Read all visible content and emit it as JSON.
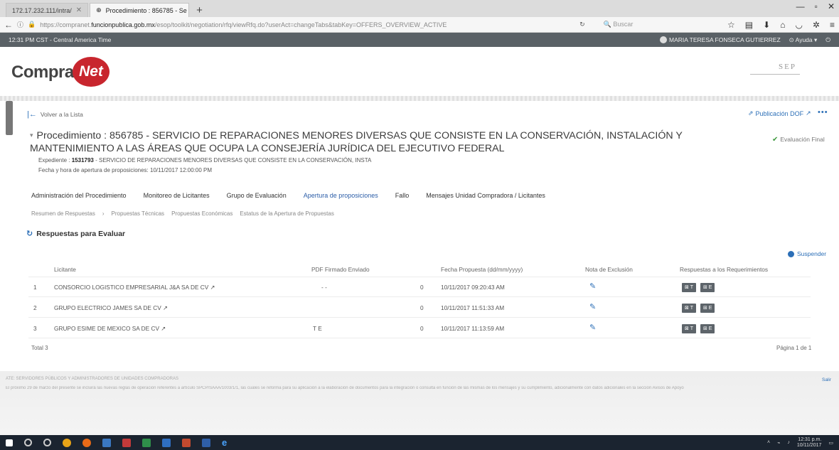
{
  "browser": {
    "tabs": [
      {
        "label": "172.17.232.111/intra/",
        "active": false
      },
      {
        "label": "Procedimiento : 856785 - Se",
        "active": true
      }
    ],
    "url_prefix": "https://compranet.",
    "url_domain": "funcionpublica.gob.mx",
    "url_rest": "/esop/toolkit/negotiation/rfq/viewRfq.do?userAct=changeTabs&tabKey=OFFERS_OVERVIEW_ACTIVE",
    "search_placeholder": "Buscar"
  },
  "appbar": {
    "time": "12:31 PM CST - Central America Time",
    "user": "MARIA TERESA FONSECA GUTIERREZ",
    "help": "Ayuda"
  },
  "brand": {
    "logo_compra": "Compra",
    "logo_net": "Net",
    "agency": "SEP"
  },
  "nav": {
    "back": "Volver a la Lista",
    "dof": "Publicación DOF",
    "more": "•••"
  },
  "procedure": {
    "title": "Procedimiento : 856785 - SERVICIO DE REPARACIONES MENORES DIVERSAS QUE CONSISTE EN LA CONSERVACIÓN, INSTALACIÓN Y MANTENIMIENTO A LAS ÁREAS QUE OCUPA LA CONSEJERÍA JURÍDICA DEL EJECUTIVO FEDERAL",
    "status": "Evaluación Final",
    "expediente_label": "Expediente :",
    "expediente_num": "1531793",
    "expediente_desc": "- SERVICIO DE REPARACIONES MENORES DIVERSAS QUE CONSISTE EN LA CONSERVACIÓN, INSTA",
    "opening_label": "Fecha y hora de apertura de proposiciones:",
    "opening_date": "10/11/2017 12:00:00 PM"
  },
  "tabs": [
    "Administración del Procedimiento",
    "Monitoreo de Licitantes",
    "Grupo de Evaluación",
    "Apertura de proposiciones",
    "Fallo",
    "Mensajes Unidad Compradora / Licitantes"
  ],
  "subtabs": [
    "Resumen de Respuestas",
    "Propuestas Técnicas",
    "Propuestas Económicas",
    "Estatus de la Apertura de Propuestas"
  ],
  "section_title": "Respuestas para Evaluar",
  "suspend": "Suspender",
  "table": {
    "headers": [
      "Licitante",
      "PDF Firmado Enviado",
      "Fecha Propuesta (dd/mm/yyyy)",
      "Nota de Exclusión",
      "Respuestas a los Requerimientos"
    ],
    "rows": [
      {
        "n": "1",
        "bidder": "CONSORCIO LOGISTICO EMPRESARIAL J&A SA DE CV",
        "pdf": "- -",
        "count": "0",
        "date": "10/11/2017 09:20:43 AM"
      },
      {
        "n": "2",
        "bidder": "GRUPO ELECTRICO JAMES SA DE CV",
        "pdf": "",
        "count": "0",
        "date": "10/11/2017 11:51:33 AM"
      },
      {
        "n": "3",
        "bidder": "GRUPO ESIME DE MEXICO SA DE CV",
        "pdf": "T E",
        "count": "0",
        "date": "10/11/2017 11:13:59 AM"
      }
    ],
    "btn_t": "T",
    "btn_e": "E"
  },
  "total": "Total 3",
  "page": "Página 1 de 1",
  "footer": {
    "line1": "ATE: SERVIDORES PÚBLICOS Y ADMINISTRADORES DE UNIDADES COMPRADORAS",
    "line2": "El próximo 29 de marzo del presente se incluirá las nuevas reglas de operación referentes a artículo SPCP/SAAA/1003/1/1, las cuales se reforma para su aplicación a la elaboración de documentos para la integración o consulta en función de las mismas de los mensajes y su cumplimiento, adicionalmente con datos adicionales en la sección Avisos de Apoyo",
    "link": "Salir"
  },
  "taskbar": {
    "time": "12:31 p.m.",
    "date": "10/11/2017"
  }
}
